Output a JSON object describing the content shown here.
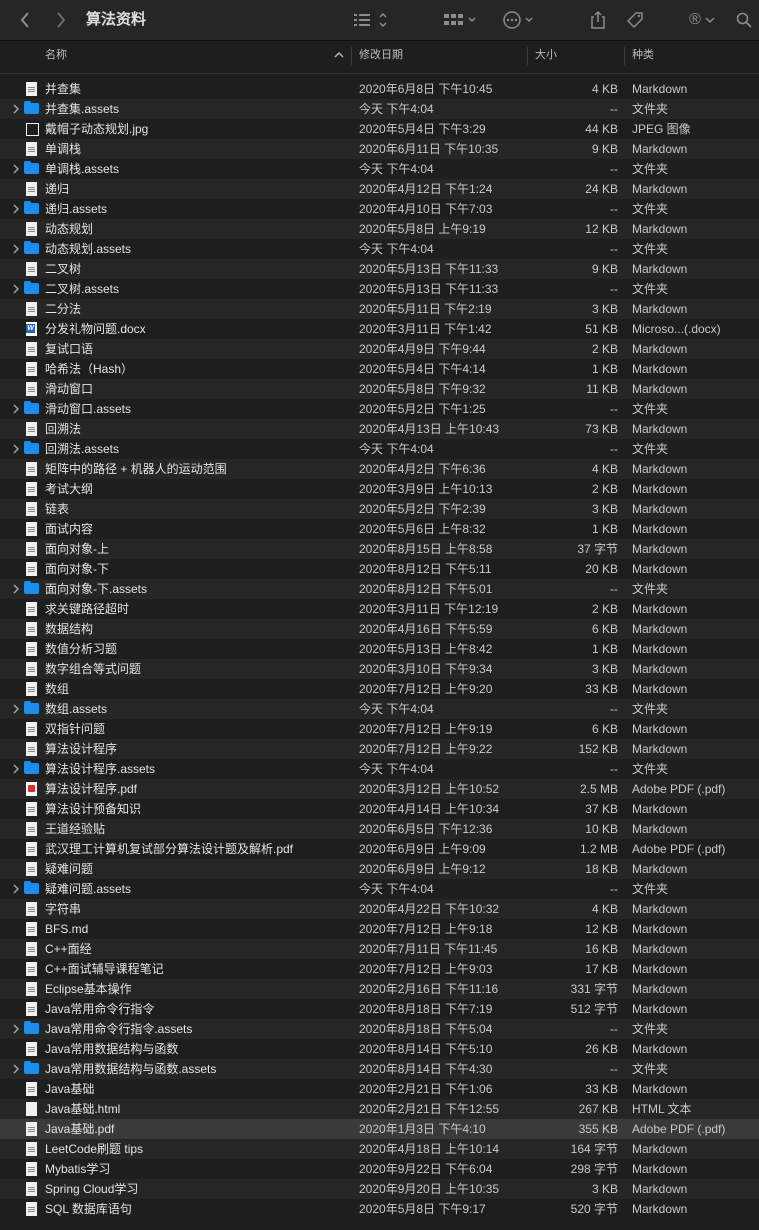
{
  "window": {
    "title": "算法资料",
    "icons": {
      "back": "chevron-left-icon",
      "forward": "chevron-right-icon",
      "list_view": "list-view-icon",
      "grid_view": "grid-view-icon",
      "more": "ellipsis-circle-icon",
      "share": "share-icon",
      "tag": "tag-icon",
      "registered": "registered-icon",
      "search": "search-icon"
    },
    "registered_glyph": "®"
  },
  "columns": {
    "name": "名称",
    "date": "修改日期",
    "size": "大小",
    "kind": "种类"
  },
  "files": [
    {
      "name": "并查集",
      "date": "2020年6月8日 下午10:45",
      "size": "4 KB",
      "kind": "Markdown",
      "type": "md",
      "folder": false
    },
    {
      "name": "并查集.assets",
      "date": "今天 下午4:04",
      "size": "--",
      "kind": "文件夹",
      "type": "folder",
      "folder": true
    },
    {
      "name": "戴帽子动态规划.jpg",
      "date": "2020年5月4日 下午3:29",
      "size": "44 KB",
      "kind": "JPEG 图像",
      "type": "img",
      "folder": false
    },
    {
      "name": "单调栈",
      "date": "2020年6月11日 下午10:35",
      "size": "9 KB",
      "kind": "Markdown",
      "type": "md",
      "folder": false
    },
    {
      "name": "单调栈.assets",
      "date": "今天 下午4:04",
      "size": "--",
      "kind": "文件夹",
      "type": "folder",
      "folder": true
    },
    {
      "name": "递归",
      "date": "2020年4月12日 下午1:24",
      "size": "24 KB",
      "kind": "Markdown",
      "type": "md",
      "folder": false
    },
    {
      "name": "递归.assets",
      "date": "2020年4月10日 下午7:03",
      "size": "--",
      "kind": "文件夹",
      "type": "folder",
      "folder": true
    },
    {
      "name": "动态规划",
      "date": "2020年5月8日 上午9:19",
      "size": "12 KB",
      "kind": "Markdown",
      "type": "md",
      "folder": false
    },
    {
      "name": "动态规划.assets",
      "date": "今天 下午4:04",
      "size": "--",
      "kind": "文件夹",
      "type": "folder",
      "folder": true
    },
    {
      "name": "二叉树",
      "date": "2020年5月13日 下午11:33",
      "size": "9 KB",
      "kind": "Markdown",
      "type": "md",
      "folder": false
    },
    {
      "name": "二叉树.assets",
      "date": "2020年5月13日 下午11:33",
      "size": "--",
      "kind": "文件夹",
      "type": "folder",
      "folder": true
    },
    {
      "name": "二分法",
      "date": "2020年5月11日 下午2:19",
      "size": "3 KB",
      "kind": "Markdown",
      "type": "md",
      "folder": false
    },
    {
      "name": "分发礼物问题.docx",
      "date": "2020年3月11日 下午1:42",
      "size": "51 KB",
      "kind": "Microso...(.docx)",
      "type": "word",
      "folder": false
    },
    {
      "name": "复试口语",
      "date": "2020年4月9日 下午9:44",
      "size": "2 KB",
      "kind": "Markdown",
      "type": "md",
      "folder": false
    },
    {
      "name": "哈希法（Hash）",
      "date": "2020年5月4日 下午4:14",
      "size": "1 KB",
      "kind": "Markdown",
      "type": "md",
      "folder": false
    },
    {
      "name": "滑动窗口",
      "date": "2020年5月8日 下午9:32",
      "size": "11 KB",
      "kind": "Markdown",
      "type": "md",
      "folder": false
    },
    {
      "name": "滑动窗口.assets",
      "date": "2020年5月2日 下午1:25",
      "size": "--",
      "kind": "文件夹",
      "type": "folder",
      "folder": true
    },
    {
      "name": "回溯法",
      "date": "2020年4月13日 上午10:43",
      "size": "73 KB",
      "kind": "Markdown",
      "type": "md",
      "folder": false
    },
    {
      "name": "回溯法.assets",
      "date": "今天 下午4:04",
      "size": "--",
      "kind": "文件夹",
      "type": "folder",
      "folder": true
    },
    {
      "name": "矩阵中的路径 + 机器人的运动范围",
      "date": "2020年4月2日 下午6:36",
      "size": "4 KB",
      "kind": "Markdown",
      "type": "md",
      "folder": false
    },
    {
      "name": "考试大纲",
      "date": "2020年3月9日 上午10:13",
      "size": "2 KB",
      "kind": "Markdown",
      "type": "md",
      "folder": false
    },
    {
      "name": "链表",
      "date": "2020年5月2日 下午2:39",
      "size": "3 KB",
      "kind": "Markdown",
      "type": "md",
      "folder": false
    },
    {
      "name": "面试内容",
      "date": "2020年5月6日 上午8:32",
      "size": "1 KB",
      "kind": "Markdown",
      "type": "md",
      "folder": false
    },
    {
      "name": "面向对象-上",
      "date": "2020年8月15日 上午8:58",
      "size": "37 字节",
      "kind": "Markdown",
      "type": "md",
      "folder": false
    },
    {
      "name": "面向对象-下",
      "date": "2020年8月12日 下午5:11",
      "size": "20 KB",
      "kind": "Markdown",
      "type": "md",
      "folder": false
    },
    {
      "name": "面向对象-下.assets",
      "date": "2020年8月12日 下午5:01",
      "size": "--",
      "kind": "文件夹",
      "type": "folder",
      "folder": true
    },
    {
      "name": "求关键路径超时",
      "date": "2020年3月11日 下午12:19",
      "size": "2 KB",
      "kind": "Markdown",
      "type": "md",
      "folder": false
    },
    {
      "name": "数据结构",
      "date": "2020年4月16日 下午5:59",
      "size": "6 KB",
      "kind": "Markdown",
      "type": "md",
      "folder": false
    },
    {
      "name": "数值分析习题",
      "date": "2020年5月13日 上午8:42",
      "size": "1 KB",
      "kind": "Markdown",
      "type": "md",
      "folder": false
    },
    {
      "name": "数字组合等式问题",
      "date": "2020年3月10日 下午9:34",
      "size": "3 KB",
      "kind": "Markdown",
      "type": "md",
      "folder": false
    },
    {
      "name": "数组",
      "date": "2020年7月12日 上午9:20",
      "size": "33 KB",
      "kind": "Markdown",
      "type": "md",
      "folder": false
    },
    {
      "name": "数组.assets",
      "date": "今天 下午4:04",
      "size": "--",
      "kind": "文件夹",
      "type": "folder",
      "folder": true
    },
    {
      "name": "双指针问题",
      "date": "2020年7月12日 上午9:19",
      "size": "6 KB",
      "kind": "Markdown",
      "type": "md",
      "folder": false
    },
    {
      "name": "算法设计程序",
      "date": "2020年7月12日 上午9:22",
      "size": "152 KB",
      "kind": "Markdown",
      "type": "md",
      "folder": false
    },
    {
      "name": "算法设计程序.assets",
      "date": "今天 下午4:04",
      "size": "--",
      "kind": "文件夹",
      "type": "folder",
      "folder": true
    },
    {
      "name": "算法设计程序.pdf",
      "date": "2020年3月12日 上午10:52",
      "size": "2.5 MB",
      "kind": "Adobe PDF (.pdf)",
      "type": "pdf",
      "folder": false
    },
    {
      "name": "算法设计预备知识",
      "date": "2020年4月14日 上午10:34",
      "size": "37 KB",
      "kind": "Markdown",
      "type": "md",
      "folder": false
    },
    {
      "name": "王道经验贴",
      "date": "2020年6月5日 下午12:36",
      "size": "10 KB",
      "kind": "Markdown",
      "type": "md",
      "folder": false
    },
    {
      "name": "武汉理工计算机复试部分算法设计题及解析.pdf",
      "date": "2020年6月9日 上午9:09",
      "size": "1.2 MB",
      "kind": "Adobe PDF (.pdf)",
      "type": "md",
      "folder": false
    },
    {
      "name": "疑难问题",
      "date": "2020年6月9日 上午9:12",
      "size": "18 KB",
      "kind": "Markdown",
      "type": "md",
      "folder": false
    },
    {
      "name": "疑难问题.assets",
      "date": "今天 下午4:04",
      "size": "--",
      "kind": "文件夹",
      "type": "folder",
      "folder": true
    },
    {
      "name": "字符串",
      "date": "2020年4月22日 下午10:32",
      "size": "4 KB",
      "kind": "Markdown",
      "type": "md",
      "folder": false
    },
    {
      "name": "BFS.md",
      "date": "2020年7月12日 上午9:18",
      "size": "12 KB",
      "kind": "Markdown",
      "type": "md",
      "folder": false
    },
    {
      "name": "C++面经",
      "date": "2020年7月11日 下午11:45",
      "size": "16 KB",
      "kind": "Markdown",
      "type": "md",
      "folder": false
    },
    {
      "name": "C++面试辅导课程笔记",
      "date": "2020年7月12日 上午9:03",
      "size": "17 KB",
      "kind": "Markdown",
      "type": "md",
      "folder": false
    },
    {
      "name": "Eclipse基本操作",
      "date": "2020年2月16日 下午11:16",
      "size": "331 字节",
      "kind": "Markdown",
      "type": "md",
      "folder": false
    },
    {
      "name": "Java常用命令行指令",
      "date": "2020年8月18日 下午7:19",
      "size": "512 字节",
      "kind": "Markdown",
      "type": "md",
      "folder": false
    },
    {
      "name": "Java常用命令行指令.assets",
      "date": "2020年8月18日 下午5:04",
      "size": "--",
      "kind": "文件夹",
      "type": "folder",
      "folder": true
    },
    {
      "name": "Java常用数据结构与函数",
      "date": "2020年8月14日 下午5:10",
      "size": "26 KB",
      "kind": "Markdown",
      "type": "md",
      "folder": false
    },
    {
      "name": "Java常用数据结构与函数.assets",
      "date": "2020年8月14日 下午4:30",
      "size": "--",
      "kind": "文件夹",
      "type": "folder",
      "folder": true
    },
    {
      "name": "Java基础",
      "date": "2020年2月21日 下午1:06",
      "size": "33 KB",
      "kind": "Markdown",
      "type": "md",
      "folder": false
    },
    {
      "name": "Java基础.html",
      "date": "2020年2月21日 下午12:55",
      "size": "267 KB",
      "kind": "HTML 文本",
      "type": "html",
      "folder": false
    },
    {
      "name": "Java基础.pdf",
      "date": "2020年1月3日 下午4:10",
      "size": "355 KB",
      "kind": "Adobe PDF (.pdf)",
      "type": "md",
      "folder": false,
      "selected": true
    },
    {
      "name": "LeetCode刷题 tips",
      "date": "2020年4月18日 上午10:14",
      "size": "164 字节",
      "kind": "Markdown",
      "type": "md",
      "folder": false
    },
    {
      "name": "Mybatis学习",
      "date": "2020年9月22日 下午6:04",
      "size": "298 字节",
      "kind": "Markdown",
      "type": "md",
      "folder": false
    },
    {
      "name": "Spring Cloud学习",
      "date": "2020年9月20日 上午10:35",
      "size": "3 KB",
      "kind": "Markdown",
      "type": "md",
      "folder": false
    },
    {
      "name": "SQL 数据库语句",
      "date": "2020年5月8日 下午9:17",
      "size": "520 字节",
      "kind": "Markdown",
      "type": "md",
      "folder": false
    }
  ]
}
